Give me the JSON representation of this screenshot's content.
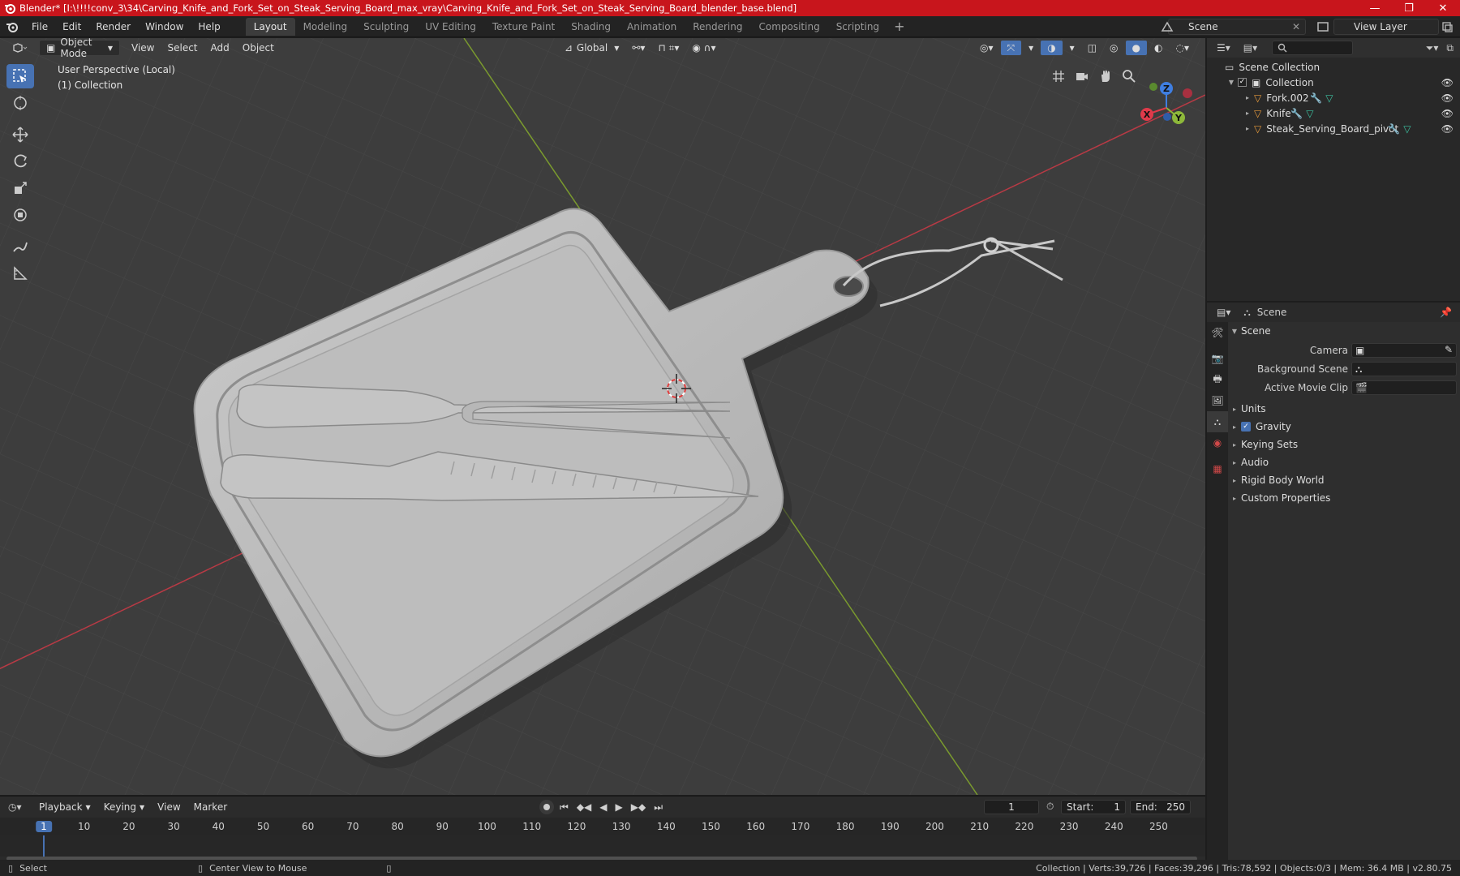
{
  "window": {
    "title": "Blender* [I:\\!!!!conv_3\\34\\Carving_Knife_and_Fork_Set_on_Steak_Serving_Board_max_vray\\Carving_Knife_and_Fork_Set_on_Steak_Serving_Board_blender_base.blend]",
    "controls": [
      "—",
      "❐",
      "✕"
    ]
  },
  "menu": [
    "File",
    "Edit",
    "Render",
    "Window",
    "Help"
  ],
  "workspaces": [
    "Layout",
    "Modeling",
    "Sculpting",
    "UV Editing",
    "Texture Paint",
    "Shading",
    "Animation",
    "Rendering",
    "Compositing",
    "Scripting"
  ],
  "active_workspace": "Layout",
  "scene_selector": "Scene",
  "view_layer": "View Layer",
  "viewport": {
    "mode": "Object Mode",
    "menus": [
      "View",
      "Select",
      "Add",
      "Object"
    ],
    "orientation": "Global",
    "perspective": "User Perspective (Local)",
    "collection_info": "(1) Collection",
    "gizmo": {
      "x": "X",
      "y": "Y",
      "z": "Z"
    }
  },
  "outliner": {
    "root": "Scene Collection",
    "collection": "Collection",
    "objects": [
      "Fork.002",
      "Knife",
      "Steak_Serving_Board_pivot"
    ]
  },
  "properties": {
    "header": "Scene",
    "panel": "Scene",
    "fields": [
      {
        "label": "Camera"
      },
      {
        "label": "Background Scene"
      },
      {
        "label": "Active Movie Clip"
      }
    ],
    "sections": [
      "Units",
      "Gravity",
      "Keying Sets",
      "Audio",
      "Rigid Body World",
      "Custom Properties"
    ],
    "gravity_checked": true
  },
  "timeline": {
    "menus": [
      "Playback",
      "Keying",
      "View",
      "Marker"
    ],
    "current_frame": "1",
    "start_label": "Start:",
    "start": "1",
    "end_label": "End:",
    "end": "250",
    "ruler": [
      "1",
      "10",
      "20",
      "30",
      "40",
      "50",
      "60",
      "70",
      "80",
      "90",
      "100",
      "110",
      "120",
      "130",
      "140",
      "150",
      "160",
      "170",
      "180",
      "190",
      "200",
      "210",
      "220",
      "230",
      "240",
      "250"
    ],
    "ruler_frames": [
      1,
      10,
      20,
      30,
      40,
      50,
      60,
      70,
      80,
      90,
      100,
      110,
      120,
      130,
      140,
      150,
      160,
      170,
      180,
      190,
      200,
      210,
      220,
      230,
      240,
      250
    ]
  },
  "status": {
    "left": "Select",
    "middle": "Center View to Mouse",
    "right": "Collection | Verts:39,726 | Faces:39,296 | Tris:78,592 | Objects:0/3 | Mem: 36.4 MB | v2.80.75"
  },
  "colors": {
    "titlebar": "#c8151c",
    "accent": "#4772b3",
    "viewport_bg": "#3d3d3d",
    "x_axis": "#e03a4a",
    "y_axis": "#8db83a",
    "z_axis": "#3f7ee0"
  }
}
